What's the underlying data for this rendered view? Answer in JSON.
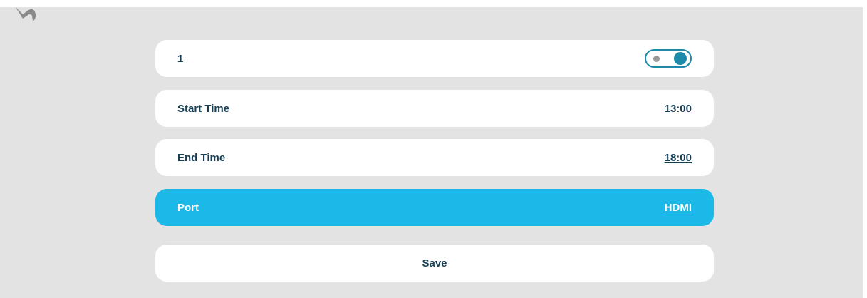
{
  "colors": {
    "background": "#e3e3e3",
    "row": "#ffffff",
    "selected_row": "#1bb8e8",
    "text": "#163f55",
    "toggle_accent": "#1c8aa8"
  },
  "header": {
    "back_icon": "back-arrow-icon"
  },
  "schedule": {
    "name_label": "1",
    "enabled": true,
    "start_time_label": "Start Time",
    "start_time_value": "13:00",
    "end_time_label": "End Time",
    "end_time_value": "18:00",
    "port_label": "Port",
    "port_value": "HDMI",
    "save_label": "Save"
  }
}
